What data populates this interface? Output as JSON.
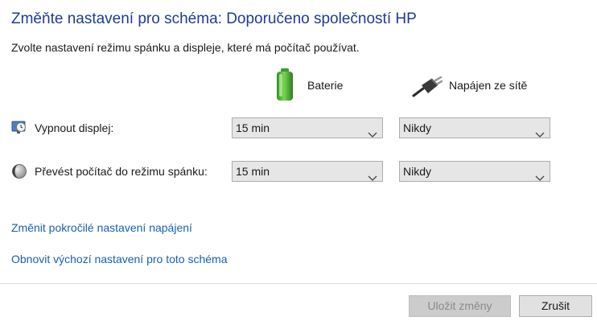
{
  "header": {
    "title": "Změňte nastavení pro schéma: Doporučeno společností HP",
    "subtitle": "Zvolte nastavení režimu spánku a displeje, které má počítač používat."
  },
  "columns": {
    "battery": {
      "label": "Baterie",
      "icon": "battery-icon"
    },
    "plugged": {
      "label": "Napájen ze sítě",
      "icon": "power-plug-icon"
    }
  },
  "settings": [
    {
      "label": "Vypnout displej:",
      "icon": "display-clock-icon",
      "battery_value": "15 min",
      "plugged_value": "Nikdy"
    },
    {
      "label": "Převést počítač do režimu spánku:",
      "icon": "moon-sleep-icon",
      "battery_value": "15 min",
      "plugged_value": "Nikdy"
    }
  ],
  "links": {
    "advanced": "Změnit pokročilé nastavení napájení",
    "restore": "Obnovit výchozí nastavení pro toto schéma"
  },
  "buttons": {
    "save": "Uložit změny",
    "cancel": "Zrušit"
  },
  "colors": {
    "title": "#1e3c94",
    "link": "#1a5fb4",
    "battery_green": "#3fae3a"
  }
}
